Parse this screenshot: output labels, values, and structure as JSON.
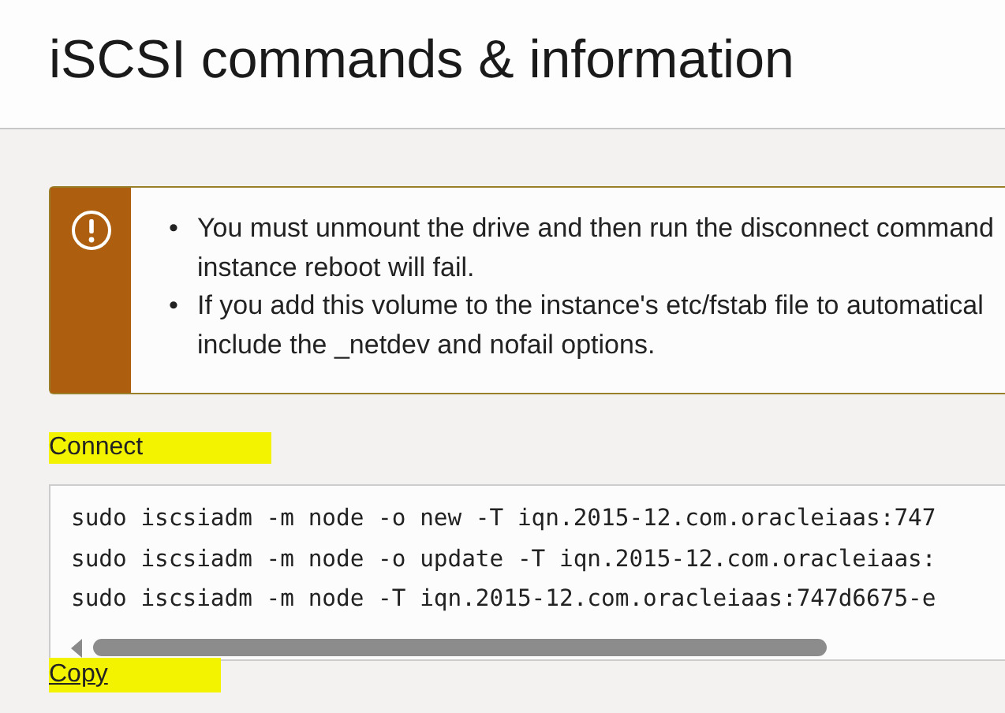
{
  "title": "iSCSI commands & information",
  "alert": {
    "items": [
      {
        "bullet": "•",
        "lines": [
          "You must unmount the drive and then run the disconnect command",
          "instance reboot will fail."
        ]
      },
      {
        "bullet": "•",
        "lines": [
          "If you add this volume to the instance's etc/fstab file to automatical",
          "include the _netdev and nofail options."
        ]
      }
    ]
  },
  "sections": [
    {
      "label": "Connect",
      "highlighted": true,
      "commands": [
        "sudo iscsiadm -m node -o new -T iqn.2015-12.com.oracleiaas:747",
        "sudo iscsiadm -m node -o update -T iqn.2015-12.com.oracleiaas:",
        "sudo iscsiadm -m node -T iqn.2015-12.com.oracleiaas:747d6675-e"
      ],
      "copy": {
        "label": "Copy",
        "highlighted": true
      }
    }
  ]
}
